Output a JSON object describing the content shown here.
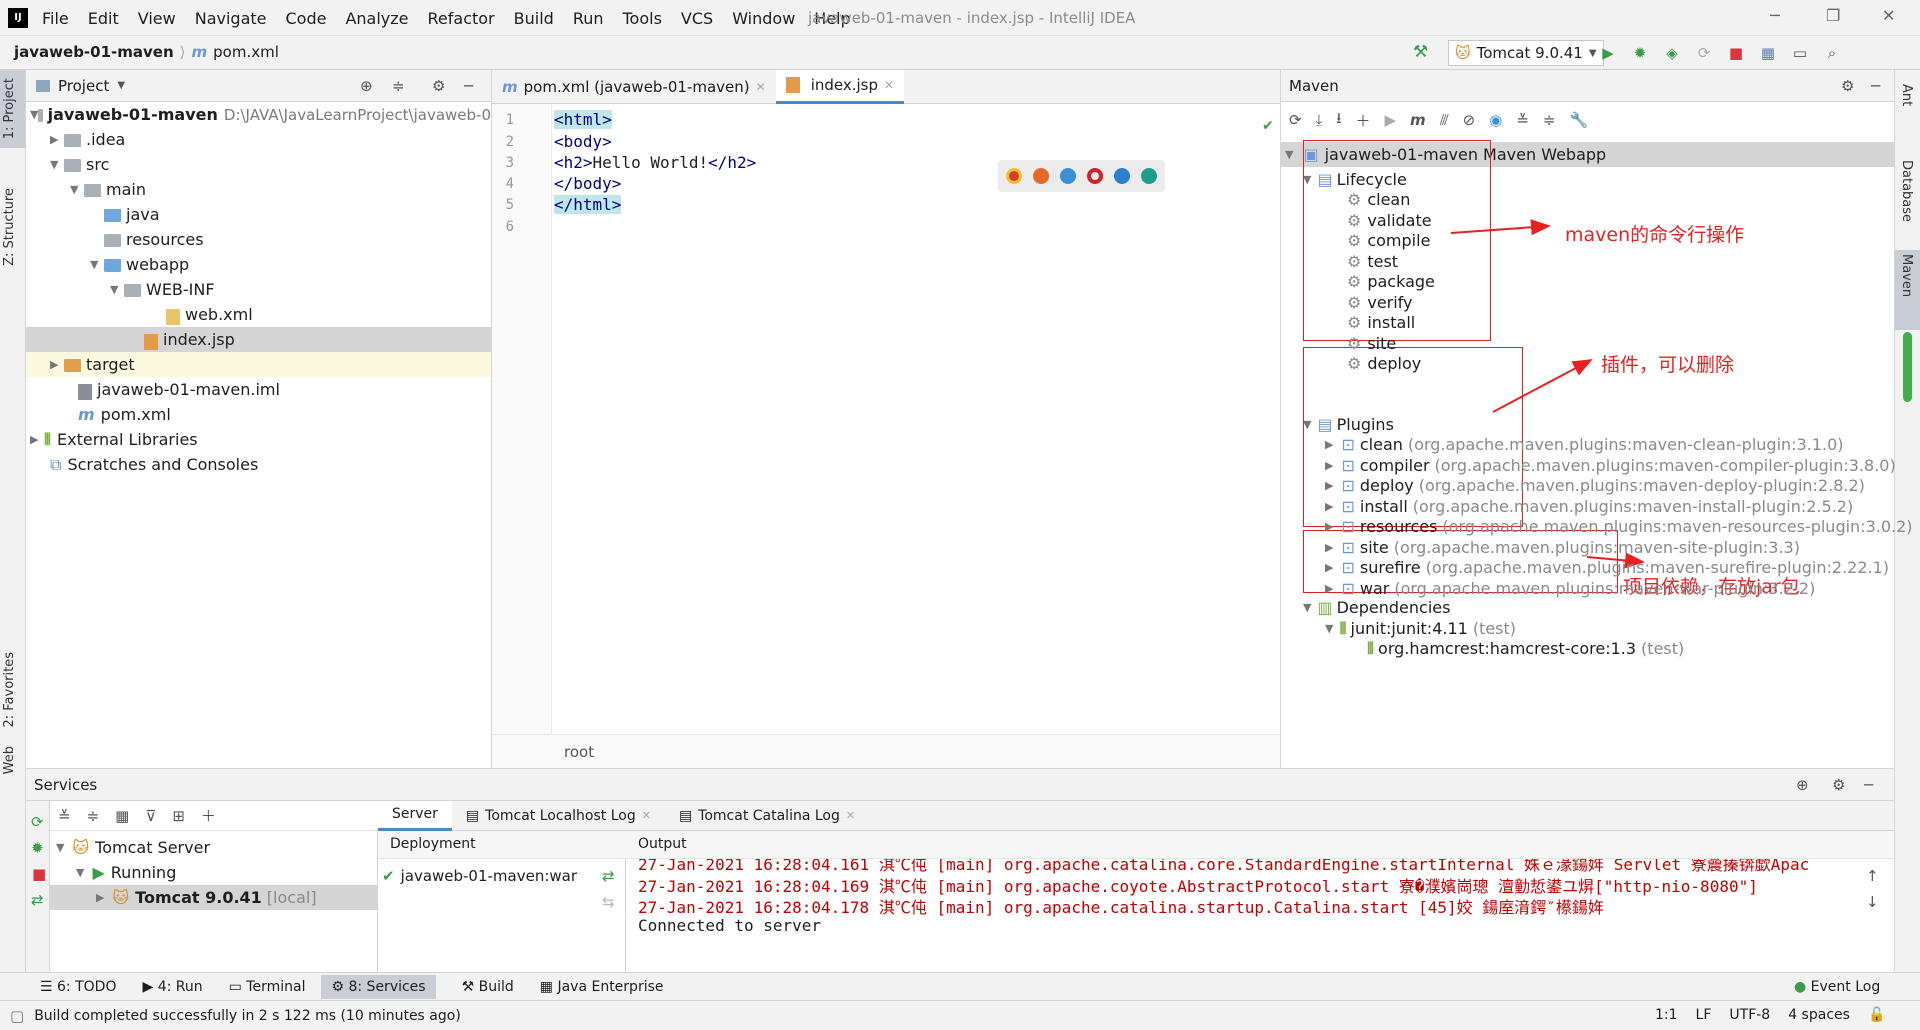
{
  "menubar": {
    "items": [
      "File",
      "Edit",
      "View",
      "Navigate",
      "Code",
      "Analyze",
      "Refactor",
      "Build",
      "Run",
      "Tools",
      "VCS",
      "Window",
      "Help"
    ],
    "title": "javaweb-01-maven - index.jsp - IntelliJ IDEA"
  },
  "navbar": {
    "project": "javaweb-01-maven",
    "file": "pom.xml",
    "run_config": "Tomcat 9.0.41"
  },
  "left_stripe": {
    "project": "1: Project",
    "structure": "Z: Structure",
    "favorites": "2: Favorites",
    "web": "Web"
  },
  "right_stripe": {
    "ant": "Ant",
    "database": "Database",
    "maven": "Maven"
  },
  "project_panel": {
    "title": "Project",
    "root": "javaweb-01-maven",
    "root_path": "D:\\JAVA\\JavaLearnProject\\javaweb-0",
    "items": [
      ".idea",
      "src",
      "main",
      "java",
      "resources",
      "webapp",
      "WEB-INF",
      "web.xml",
      "index.jsp",
      "target",
      "javaweb-01-maven.iml",
      "pom.xml",
      "External Libraries",
      "Scratches and Consoles"
    ]
  },
  "editor": {
    "tabs": [
      "pom.xml (javaweb-01-maven)",
      "index.jsp"
    ],
    "lines": [
      "1",
      "2",
      "3",
      "4",
      "5",
      "6"
    ],
    "breadcrumb": "root"
  },
  "maven": {
    "title": "Maven",
    "root": "javaweb-01-maven Maven Webapp",
    "lifecycle_label": "Lifecycle",
    "lifecycle": [
      "clean",
      "validate",
      "compile",
      "test",
      "package",
      "verify",
      "install",
      "site",
      "deploy"
    ],
    "plugins_label": "Plugins",
    "plugins": [
      {
        "name": "clean",
        "detail": "(org.apache.maven.plugins:maven-clean-plugin:3.1.0)"
      },
      {
        "name": "compiler",
        "detail": "(org.apache.maven.plugins:maven-compiler-plugin:3.8.0)"
      },
      {
        "name": "deploy",
        "detail": "(org.apache.maven.plugins:maven-deploy-plugin:2.8.2)"
      },
      {
        "name": "install",
        "detail": "(org.apache.maven.plugins:maven-install-plugin:2.5.2)"
      },
      {
        "name": "resources",
        "detail": "(org.apache.maven.plugins:maven-resources-plugin:3.0.2)"
      },
      {
        "name": "site",
        "detail": "(org.apache.maven.plugins:maven-site-plugin:3.3)"
      },
      {
        "name": "surefire",
        "detail": "(org.apache.maven.plugins:maven-surefire-plugin:2.22.1)"
      },
      {
        "name": "war",
        "detail": "(org.apache.maven.plugins:maven-war-plugin:3.2.2)"
      }
    ],
    "deps_label": "Dependencies",
    "dep1": "junit:junit:4.11",
    "dep1_scope": "(test)",
    "dep2": "org.hamcrest:hamcrest-core:1.3",
    "dep2_scope": "(test)",
    "annotation_lifecycle": "maven的命令行操作",
    "annotation_plugins": "插件，可以删除",
    "annotation_deps": "项目依赖，存放jar包"
  },
  "services": {
    "title": "Services",
    "tomcat_server": "Tomcat Server",
    "running": "Running",
    "instance": "Tomcat 9.0.41",
    "instance_tag": "[local]",
    "tabs": [
      "Server",
      "Tomcat Localhost Log",
      "Tomcat Catalina Log"
    ],
    "deployment_label": "Deployment",
    "artifact": "javaweb-01-maven:war",
    "output_label": "Output",
    "log": [
      "27-Jan-2021 16:28:04.161 淇℃伅 [main] org.apache.catalina.core.StandardEngine.startInternal 姝ｅ湪鍚姩 Servlet 寮曟搸锛歔Apac",
      "27-Jan-2021 16:28:04.169 淇℃伅 [main] org.apache.coyote.AbstractProtocol.start 寮�濮嬪崗璁 澶勭悊鍙ユ焺[\"http-nio-8080\"]",
      "27-Jan-2021 16:28:04.178 淇℃伅 [main] org.apache.catalina.startup.Catalina.start [45]姣 鍚庢湇鍔″櫒鍚姩",
      "Connected to server"
    ]
  },
  "bottom_tabs": [
    "6: TODO",
    "4: Run",
    "Terminal",
    "8: Services",
    "Build",
    "Java Enterprise",
    "Event Log"
  ],
  "status": {
    "message": "Build completed successfully in 2 s 122 ms (10 minutes ago)",
    "position": "1:1",
    "line_sep": "LF",
    "encoding": "UTF-8",
    "indent": "4 spaces"
  }
}
